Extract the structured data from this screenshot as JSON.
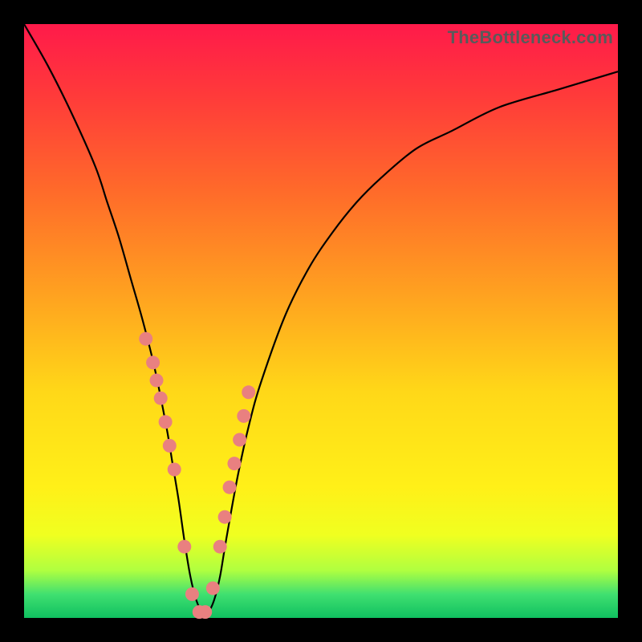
{
  "watermark": "TheBottleneck.com",
  "colors": {
    "curve_stroke": "#000000",
    "marker_fill": "#e98080",
    "marker_stroke": "#d06060"
  },
  "chart_data": {
    "type": "line",
    "title": "",
    "xlabel": "",
    "ylabel": "",
    "xlim": [
      0,
      100
    ],
    "ylim": [
      0,
      100
    ],
    "series": [
      {
        "name": "bottleneck-curve",
        "x": [
          0,
          4,
          8,
          12,
          14,
          16,
          18,
          20,
          22,
          24,
          25,
          26,
          27,
          28,
          29,
          30,
          31,
          32,
          33,
          34,
          36,
          38,
          40,
          44,
          48,
          52,
          56,
          60,
          66,
          72,
          80,
          90,
          100
        ],
        "y": [
          100,
          93,
          85,
          76,
          70,
          64,
          57,
          50,
          42,
          32,
          26,
          20,
          13,
          7,
          3,
          1,
          1,
          3,
          7,
          13,
          24,
          33,
          40,
          51,
          59,
          65,
          70,
          74,
          79,
          82,
          86,
          89,
          92
        ]
      }
    ],
    "markers": {
      "name": "highlighted-points",
      "x": [
        20.5,
        21.7,
        22.3,
        23.0,
        23.8,
        24.5,
        25.3,
        27.0,
        28.3,
        29.5,
        30.5,
        31.8,
        33.0,
        33.8,
        34.6,
        35.4,
        36.3,
        37.0,
        37.8
      ],
      "y": [
        47,
        43,
        40,
        37,
        33,
        29,
        25,
        12,
        4,
        1,
        1,
        5,
        12,
        17,
        22,
        26,
        30,
        34,
        38
      ]
    }
  }
}
